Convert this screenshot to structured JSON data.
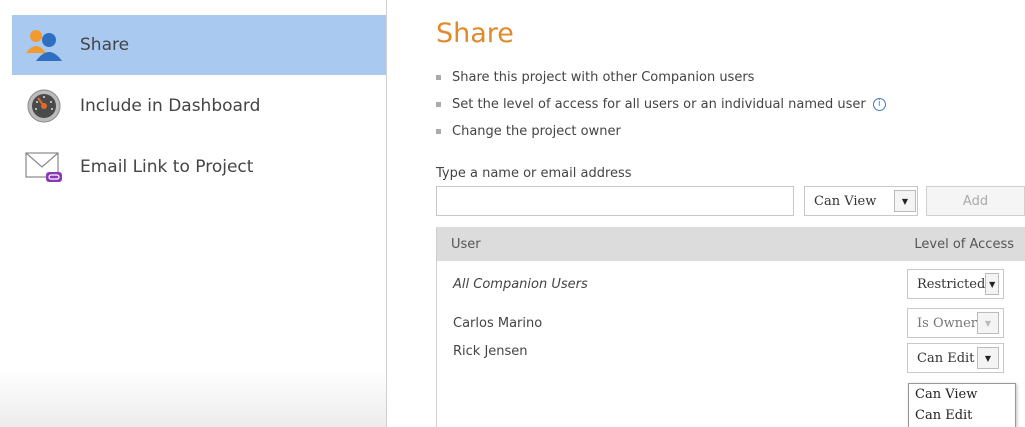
{
  "sidebar": {
    "items": [
      {
        "label": "Share",
        "icon": "users-icon",
        "active": true
      },
      {
        "label": "Include in Dashboard",
        "icon": "dashboard-gauge-icon",
        "active": false
      },
      {
        "label": "Email Link to Project",
        "icon": "email-link-icon",
        "active": false
      }
    ]
  },
  "share": {
    "title": "Share",
    "bullets": [
      "Share this project with other Companion users",
      "Set the level of access for all users or an individual named user",
      "Change the project owner"
    ],
    "info_icon": "info-icon",
    "input_prompt": "Type a name or email address",
    "input_value": "",
    "access_level": "Can View",
    "add_label": "Add"
  },
  "table": {
    "headers": {
      "user": "User",
      "access": "Level of Access"
    },
    "rows": [
      {
        "user": "All Companion Users",
        "access": "Restricted"
      },
      {
        "user": "Carlos Marino",
        "access": "Is Owner"
      },
      {
        "user": "Rick Jensen",
        "access": "Can Edit"
      }
    ]
  },
  "dropdown": {
    "options": [
      "Can View",
      "Can Edit"
    ]
  },
  "colors": {
    "accent_title": "#e28a2a",
    "active_nav": "#a9c9f0",
    "table_header": "#dcdcdc",
    "info_blue": "#3b78c4"
  }
}
